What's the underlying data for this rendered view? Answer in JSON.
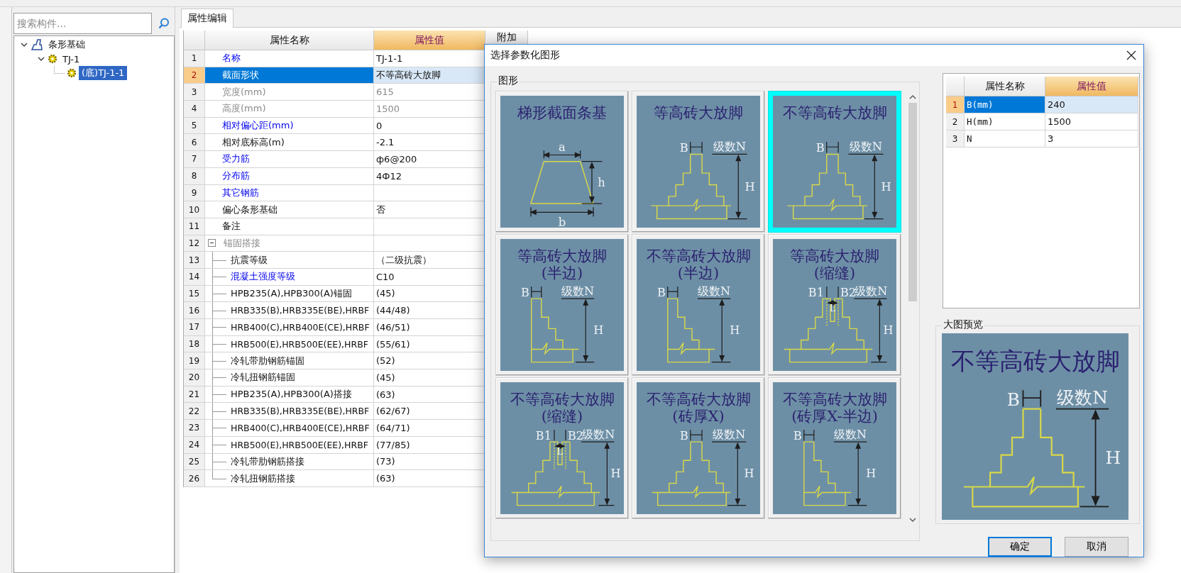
{
  "left_panel": {
    "search": {
      "placeholder": "搜索构件..."
    },
    "tree": [
      {
        "label": "条形基础",
        "kind": "category",
        "expanded": true,
        "selected": false,
        "children": [
          {
            "label": "TJ-1",
            "kind": "component",
            "expanded": true,
            "selected": false,
            "children": [
              {
                "label": "(底)TJ-1-1",
                "kind": "component",
                "selected": true
              }
            ]
          }
        ]
      }
    ]
  },
  "tabs": [
    {
      "label": "属性编辑",
      "selected": true
    }
  ],
  "property_table": {
    "columns": [
      {
        "label": "属性名称",
        "highlighted": false
      },
      {
        "label": "属性值",
        "highlighted": true
      },
      {
        "label": "附加",
        "highlighted": false
      }
    ],
    "rows": [
      {
        "num": "1",
        "name": "名称",
        "value": "TJ-1-1",
        "kind": "link",
        "selected": false
      },
      {
        "num": "2",
        "name": "截面形状",
        "value": "不等高砖大放脚",
        "kind": "plain",
        "selected": true
      },
      {
        "num": "3",
        "name": "宽度(mm)",
        "value": "615",
        "kind": "readonly",
        "selected": false
      },
      {
        "num": "4",
        "name": "高度(mm)",
        "value": "1500",
        "kind": "readonly",
        "selected": false
      },
      {
        "num": "5",
        "name": "相对偏心距(mm)",
        "value": "0",
        "kind": "link",
        "selected": false
      },
      {
        "num": "6",
        "name": "相对底标高(m)",
        "value": "-2.1",
        "kind": "plain",
        "selected": false
      },
      {
        "num": "7",
        "name": "受力筋",
        "value": "ф6@200",
        "kind": "link",
        "selected": false
      },
      {
        "num": "8",
        "name": "分布筋",
        "value": "4Ф12",
        "kind": "link",
        "selected": false
      },
      {
        "num": "9",
        "name": "其它钢筋",
        "kind": "link",
        "selected": false
      },
      {
        "num": "10",
        "name": "偏心条形基础",
        "value": "否",
        "kind": "plain",
        "selected": false
      },
      {
        "num": "11",
        "name": "备注",
        "kind": "plain",
        "selected": false
      },
      {
        "num": "12",
        "name": "锚固搭接",
        "kind": "group",
        "expanded": true,
        "selected": false,
        "children": [
          {
            "num": "13",
            "name": "抗震等级",
            "value": "（二级抗震）",
            "kind": "plain",
            "selected": false
          },
          {
            "num": "14",
            "name": "混凝土强度等级",
            "value": "C10",
            "kind": "link",
            "selected": false
          },
          {
            "num": "15",
            "name": "HPB235(A),HPB300(A)锚固",
            "value": "(45)",
            "kind": "plain",
            "selected": false
          },
          {
            "num": "16",
            "name": "HRB335(B),HRB335E(BE),HRBF",
            "value": "(44/48)",
            "kind": "plain",
            "selected": false
          },
          {
            "num": "17",
            "name": "HRB400(C),HRB400E(CE),HRBF",
            "value": "(46/51)",
            "kind": "plain",
            "selected": false
          },
          {
            "num": "18",
            "name": "HRB500(E),HRB500E(EE),HRBF",
            "value": "(55/61)",
            "kind": "plain",
            "selected": false
          },
          {
            "num": "19",
            "name": "冷轧带肋钢筋锚固",
            "value": "(52)",
            "kind": "plain",
            "selected": false
          },
          {
            "num": "20",
            "name": "冷轧扭钢筋锚固",
            "value": "(45)",
            "kind": "plain",
            "selected": false
          },
          {
            "num": "21",
            "name": "HPB235(A),HPB300(A)搭接",
            "value": "(63)",
            "kind": "plain",
            "selected": false
          },
          {
            "num": "22",
            "name": "HRB335(B),HRB335E(BE),HRBF",
            "value": "(62/67)",
            "kind": "plain",
            "selected": false
          },
          {
            "num": "23",
            "name": "HRB400(C),HRB400E(CE),HRBF",
            "value": "(64/71)",
            "kind": "plain",
            "selected": false
          },
          {
            "num": "24",
            "name": "HRB500(E),HRB500E(EE),HRBF",
            "value": "(77/85)",
            "kind": "plain",
            "selected": false
          },
          {
            "num": "25",
            "name": "冷轧带肋钢筋搭接",
            "value": "(73)",
            "kind": "plain",
            "selected": false
          },
          {
            "num": "26",
            "name": "冷轧扭钢筋搭接",
            "value": "(63)",
            "kind": "plain",
            "selected": false
          }
        ]
      }
    ]
  },
  "dialog": {
    "title": "选择参数化图形",
    "shape_group": {
      "label": "图形",
      "shapes": [
        {
          "title": "梯形截面条基",
          "kind": "trapezoid",
          "labels": [
            "a",
            "h",
            "b"
          ],
          "selected": false
        },
        {
          "title": "等高砖大放脚",
          "kind": "full",
          "labels": [
            "B",
            "级数N",
            "H"
          ],
          "selected": false
        },
        {
          "title": "不等高砖大放脚",
          "kind": "full",
          "labels": [
            "B",
            "级数N",
            "H"
          ],
          "selected": true
        },
        {
          "title": "等高砖大放脚(半边)",
          "kind": "half",
          "labels": [
            "B",
            "级数N",
            "H"
          ],
          "selected": false
        },
        {
          "title": "不等高砖大放脚(半边)",
          "kind": "half",
          "labels": [
            "B",
            "级数N",
            "H"
          ],
          "selected": false
        },
        {
          "title": "等高砖大放脚(缩缝)",
          "kind": "joint",
          "labels": [
            "B1",
            "L",
            "B2",
            "级数N",
            "H"
          ],
          "selected": false
        },
        {
          "title": "不等高砖大放脚(缩缝)",
          "kind": "joint",
          "labels": [
            "B1",
            "L",
            "B2",
            "级数N",
            "H"
          ],
          "selected": false
        },
        {
          "title": "不等高砖大放脚(砖厚X)",
          "kind": "full",
          "labels": [
            "B",
            "级数N",
            "H"
          ],
          "selected": false
        },
        {
          "title": "不等高砖大放脚(砖厚X-半边)",
          "kind": "half",
          "labels": [
            "B",
            "级数N",
            "H"
          ],
          "selected": false
        }
      ]
    },
    "param_table": {
      "columns": [
        {
          "label": "属性名称",
          "highlighted": false
        },
        {
          "label": "属性值",
          "highlighted": true
        }
      ],
      "rows": [
        {
          "num": "1",
          "name": "B(mm)",
          "value": "240",
          "selected": true
        },
        {
          "num": "2",
          "name": "H(mm)",
          "value": "1500",
          "selected": false
        },
        {
          "num": "3",
          "name": "N",
          "value": "3",
          "selected": false
        }
      ]
    },
    "preview": {
      "label": "大图预览",
      "title": "不等高砖大放脚",
      "kind": "full",
      "labels": [
        "B",
        "级数N",
        "H"
      ]
    },
    "buttons": [
      {
        "label": "确定",
        "default": true
      },
      {
        "label": "取消",
        "default": false
      }
    ]
  }
}
